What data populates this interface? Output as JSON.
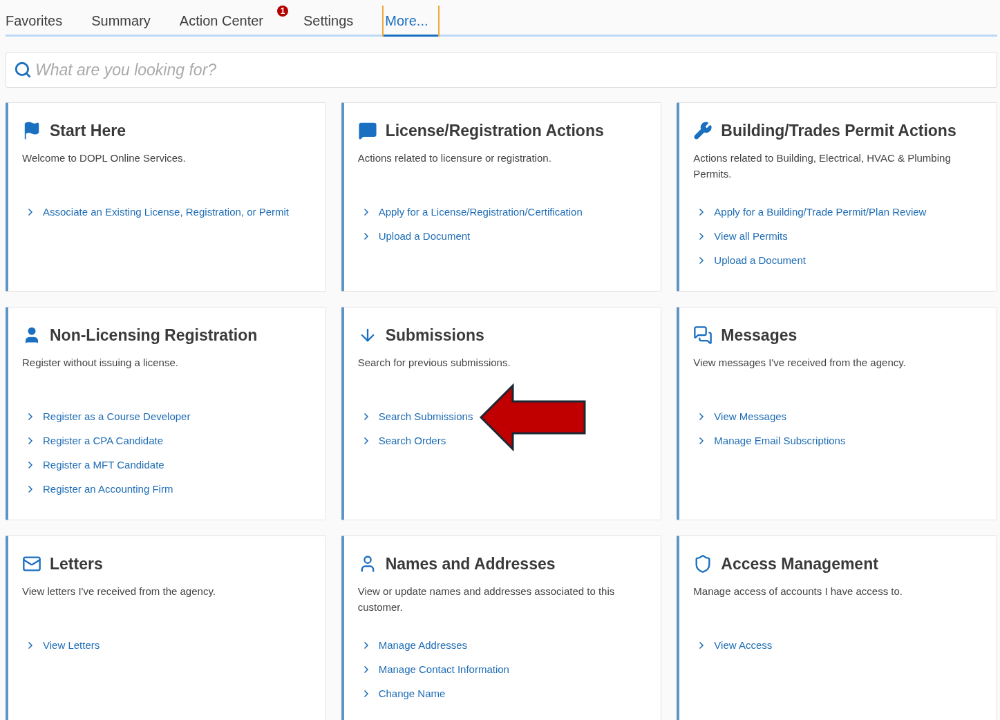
{
  "tabs": [
    {
      "label": "Favorites",
      "selected": false
    },
    {
      "label": "Summary",
      "selected": false
    },
    {
      "label": "Action Center",
      "selected": false,
      "badge": "1"
    },
    {
      "label": "Settings",
      "selected": false
    },
    {
      "label": "More...",
      "selected": true
    }
  ],
  "search": {
    "placeholder": "What are you looking for?"
  },
  "cards": [
    {
      "title": "Start Here",
      "description": "Welcome to DOPL Online Services.",
      "links": [
        {
          "label": "Associate an Existing License, Registration, or Permit",
          "highlighted": false
        }
      ]
    },
    {
      "title": "License/Registration Actions",
      "description": "Actions related to licensure or registration.",
      "links": [
        {
          "label": "Apply for a License/Registration/Certification",
          "highlighted": false
        },
        {
          "label": "Upload a Document",
          "highlighted": false
        }
      ]
    },
    {
      "title": "Building/Trades Permit Actions",
      "description": "Actions related to Building, Electrical, HVAC & Plumbing Permits.",
      "links": [
        {
          "label": "Apply for a Building/Trade Permit/Plan Review",
          "highlighted": false
        },
        {
          "label": "View all Permits",
          "highlighted": false
        },
        {
          "label": "Upload a Document",
          "highlighted": false
        }
      ]
    },
    {
      "title": "Non-Licensing Registration",
      "description": "Register without issuing a license.",
      "links": [
        {
          "label": "Register as a Course Developer",
          "highlighted": false
        },
        {
          "label": "Register a CPA Candidate",
          "highlighted": false
        },
        {
          "label": "Register a MFT Candidate",
          "highlighted": false
        },
        {
          "label": "Register an Accounting Firm",
          "highlighted": false
        }
      ]
    },
    {
      "title": "Submissions",
      "description": "Search for previous submissions.",
      "links": [
        {
          "label": "Search Submissions",
          "highlighted": true
        },
        {
          "label": "Search Orders",
          "highlighted": false
        }
      ]
    },
    {
      "title": "Messages",
      "description": "View messages I've received from the agency.",
      "links": [
        {
          "label": "View Messages",
          "highlighted": false
        },
        {
          "label": "Manage Email Subscriptions",
          "highlighted": false
        }
      ]
    },
    {
      "title": "Letters",
      "description": "View letters I've received from the agency.",
      "links": [
        {
          "label": "View Letters",
          "highlighted": false
        }
      ]
    },
    {
      "title": "Names and Addresses",
      "description": "View or update names and addresses associated to this customer.",
      "links": [
        {
          "label": "Manage Addresses",
          "highlighted": false
        },
        {
          "label": "Manage Contact Information",
          "highlighted": false
        },
        {
          "label": "Change Name",
          "highlighted": false
        }
      ]
    },
    {
      "title": "Access Management",
      "description": "Manage access of accounts I have access to.",
      "links": [
        {
          "label": "View Access",
          "highlighted": false
        }
      ]
    }
  ]
}
